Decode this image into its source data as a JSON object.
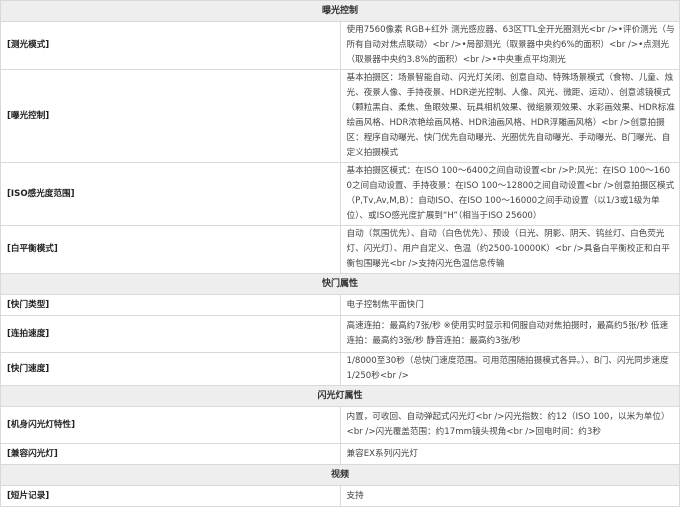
{
  "sections": [
    {
      "title": "曝光控制",
      "rows": [
        {
          "label": "[测光模式]",
          "value": "使用7560像素 RGB+红外 测光感应器、63区TTL全开光圈测光<br />•评价测光（与所有自动对焦点联动）<br />•局部测光（取景器中央约6%的面积）<br />•点测光（取景器中央约3.8%的面积）<br />•中央重点平均测光",
          "size": "md"
        },
        {
          "label": "[曝光控制]",
          "value": "基本拍摄区：场景智能自动、闪光灯关闭、创意自动、特殊场景模式（食物、儿童、烛光、夜景人像、手持夜景、HDR逆光控制、人像、风光、微距、运动）、创意滤镜模式（颗粒黑白、柔焦、鱼眼效果、玩具相机效果、微缩景观效果、水彩画效果、HDR标准绘画风格、HDR浓艳绘画风格、HDR油画风格、HDR浮雕画风格）<br />创意拍摄区：程序自动曝光、快门优先自动曝光、光圈优先自动曝光、手动曝光、B门曝光、自定义拍摄模式",
          "size": "lg"
        },
        {
          "label": "[ISO感光度范围]",
          "value": "基本拍摄区模式：在ISO 100～6400之间自动设置<br />P:风光：在ISO 100～1600之间自动设置、手持夜景：在ISO 100～12800之间自动设置<br />创意拍摄区模式（P,Tv,Av,M,B）：自动ISO、在ISO 100～16000之间手动设置（以1/3或1级为单位）、或ISO感光度扩展到“H”（相当于ISO 25600）",
          "size": "lg-iso"
        },
        {
          "label": "[白平衡模式]",
          "value": "自动（氛围优先）、自动（白色优先）、预设（日光、阴影、阴天、钨丝灯、白色荧光灯、闪光灯）、用户自定义、色温（约2500-10000K）<br />具备白平衡校正和白平衡包围曝光<br />支持闪光色温信息传输",
          "size": "md"
        }
      ]
    },
    {
      "title": "快门属性",
      "rows": [
        {
          "label": "[快门类型]",
          "value": "电子控制焦平面快门",
          "size": "sm"
        },
        {
          "label": "[连拍速度]",
          "value": "高速连拍：最高约7张/秒 ※使用实时显示和伺服自动对焦拍摄时，最高约5张/秒 低速连拍：最高约3张/秒 静音连拍：最高约3张/秒",
          "size": "md"
        },
        {
          "label": "[快门速度]",
          "value": "1/8000至30秒（总快门速度范围。可用范围随拍摄模式各异。）、B门、闪光同步速度1/250秒<br />",
          "size": "sm"
        }
      ]
    },
    {
      "title": "闪光灯属性",
      "rows": [
        {
          "label": "[机身闪光灯特性]",
          "value": "内置，可收回、自动弹起式闪光灯<br />闪光指数：约12（ISO 100，以米为单位）<br />闪光覆盖范围：约17mm镜头视角<br />回电时间：约3秒",
          "size": "md"
        },
        {
          "label": "[兼容闪光灯]",
          "value": "兼容EX系列闪光灯",
          "size": "sm"
        }
      ]
    },
    {
      "title": "视频",
      "rows": [
        {
          "label": "[短片记录]",
          "value": "支持",
          "size": "sm"
        }
      ]
    }
  ]
}
